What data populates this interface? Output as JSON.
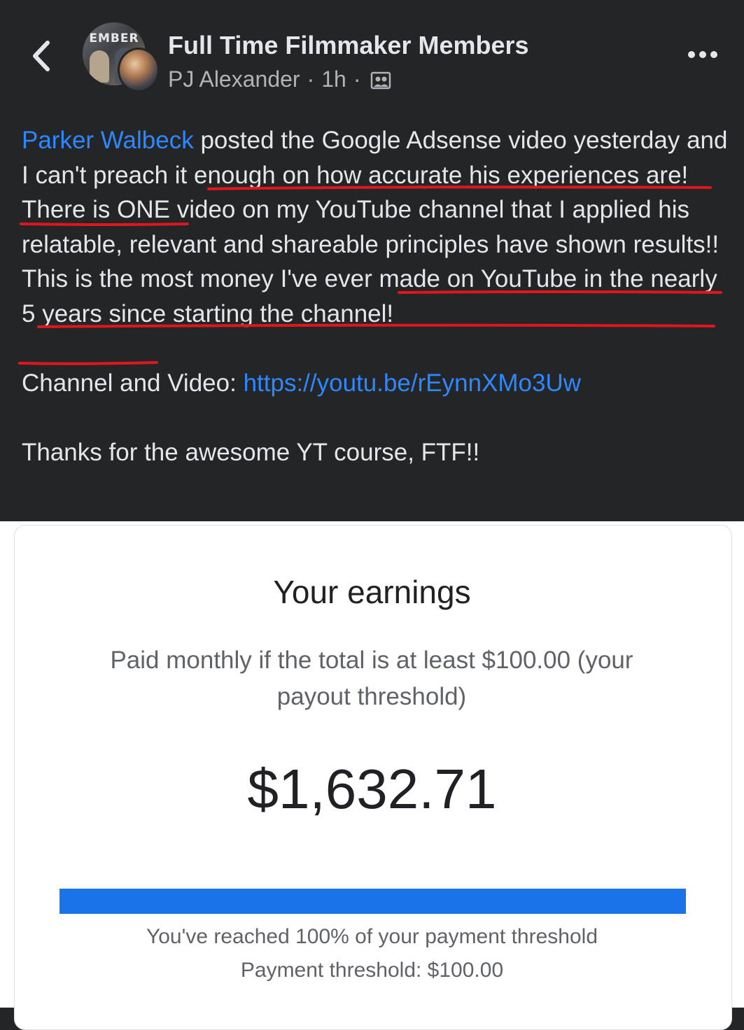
{
  "header": {
    "back_icon": "chevron-left-icon",
    "group_name": "Full Time Filmmaker Members",
    "author": "PJ Alexander",
    "dot1": "·",
    "time": "1h",
    "dot2": "·",
    "audience_icon": "group-audience-icon",
    "more_icon": "more-dots-icon",
    "avatar_banner": "EMBER"
  },
  "post": {
    "mention": "Parker Walbeck",
    "line1_rest": " posted the Google Adsense video yesterday and I ",
    "ul1": "can't preach it enough on how accurate his experiences are",
    "after_ul1": "! There is ONE video on my YouTube channel that I applied his relatable, relevant and shareable principles have shown results!! ",
    "ul2": "This is the most money I've ever made on YouTube in the nearly 5 years since starting the channel",
    "after_ul2": "!",
    "channel_label": "Channel and Video: ",
    "link": "https://youtu.be/rEynnXMo3Uw",
    "thanks": "Thanks for the awesome YT course, FTF!!",
    "underline_color": "#e0161c"
  },
  "earnings_card": {
    "title": "Your earnings",
    "subtitle": "Paid monthly if the total is at least $100.00 (your payout threshold)",
    "amount": "$1,632.71",
    "progress_fraction": 1.0,
    "progress_color": "#1a73e8",
    "progress_text": "You've reached 100% of your payment threshold",
    "threshold_text": "Payment threshold: $100.00"
  }
}
